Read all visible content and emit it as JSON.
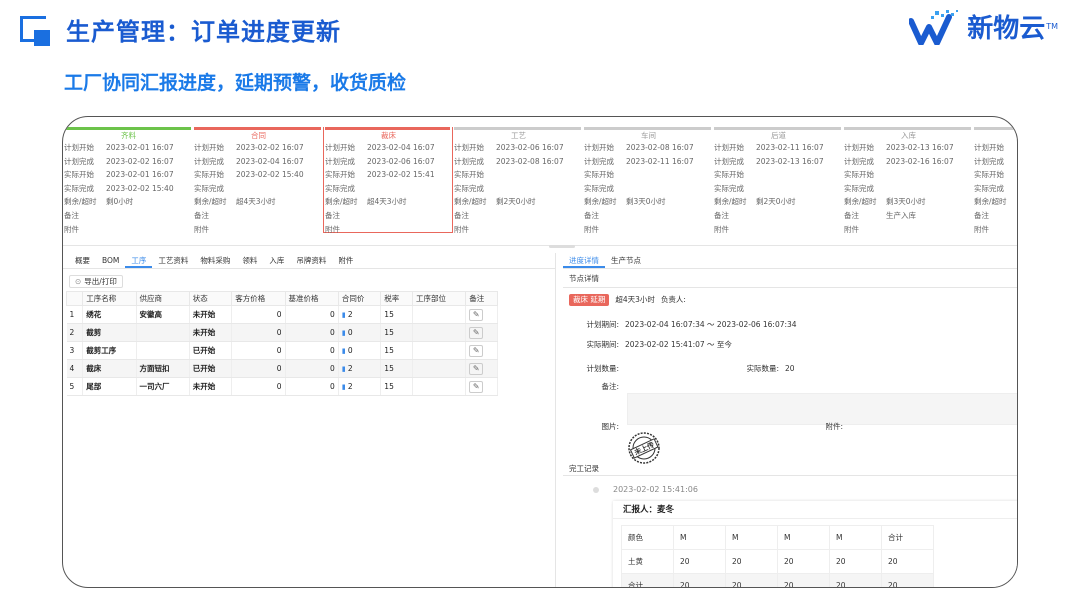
{
  "header": {
    "title": "生产管理：订单进度更新",
    "logo_text": "新物云",
    "logo_tm": "TM",
    "subtitle": "工厂协同汇报进度，延期预警，收货质检"
  },
  "stages": [
    {
      "name": "齐料",
      "state": "green",
      "rows": [
        [
          "计划开始",
          "2023-02-01 16:07"
        ],
        [
          "计划完成",
          "2023-02-02 16:07"
        ],
        [
          "实际开始",
          "2023-02-01 16:07"
        ],
        [
          "实际完成",
          "2023-02-02 15:40"
        ],
        [
          "剩余/超时",
          "剩0小时"
        ],
        [
          "备注",
          ""
        ],
        [
          "附件",
          ""
        ]
      ]
    },
    {
      "name": "合同",
      "state": "red",
      "rows": [
        [
          "计划开始",
          "2023-02-02 16:07"
        ],
        [
          "计划完成",
          "2023-02-04 16:07"
        ],
        [
          "实际开始",
          "2023-02-02 15:40"
        ],
        [
          "实际完成",
          ""
        ],
        [
          "剩余/超时",
          "超4天3小时"
        ],
        [
          "备注",
          ""
        ],
        [
          "附件",
          ""
        ]
      ]
    },
    {
      "name": "裁床",
      "state": "red-sel",
      "rows": [
        [
          "计划开始",
          "2023-02-04 16:07"
        ],
        [
          "计划完成",
          "2023-02-06 16:07"
        ],
        [
          "实际开始",
          "2023-02-02 15:41"
        ],
        [
          "实际完成",
          ""
        ],
        [
          "剩余/超时",
          "超4天3小时"
        ],
        [
          "备注",
          ""
        ],
        [
          "附件",
          ""
        ]
      ]
    },
    {
      "name": "工艺",
      "state": "grey",
      "rows": [
        [
          "计划开始",
          "2023-02-06 16:07"
        ],
        [
          "计划完成",
          "2023-02-08 16:07"
        ],
        [
          "实际开始",
          ""
        ],
        [
          "实际完成",
          ""
        ],
        [
          "剩余/超时",
          "剩2天0小时"
        ],
        [
          "备注",
          ""
        ],
        [
          "附件",
          ""
        ]
      ]
    },
    {
      "name": "车间",
      "state": "grey",
      "rows": [
        [
          "计划开始",
          "2023-02-08 16:07"
        ],
        [
          "计划完成",
          "2023-02-11 16:07"
        ],
        [
          "实际开始",
          ""
        ],
        [
          "实际完成",
          ""
        ],
        [
          "剩余/超时",
          "剩3天0小时"
        ],
        [
          "备注",
          ""
        ],
        [
          "附件",
          ""
        ]
      ]
    },
    {
      "name": "后道",
      "state": "grey",
      "rows": [
        [
          "计划开始",
          "2023-02-11 16:07"
        ],
        [
          "计划完成",
          "2023-02-13 16:07"
        ],
        [
          "实际开始",
          ""
        ],
        [
          "实际完成",
          ""
        ],
        [
          "剩余/超时",
          "剩2天0小时"
        ],
        [
          "备注",
          ""
        ],
        [
          "附件",
          ""
        ]
      ]
    },
    {
      "name": "入库",
      "state": "grey",
      "rows": [
        [
          "计划开始",
          "2023-02-13 16:07"
        ],
        [
          "计划完成",
          "2023-02-16 16:07"
        ],
        [
          "实际开始",
          ""
        ],
        [
          "实际完成",
          ""
        ],
        [
          "剩余/超时",
          "剩3天0小时"
        ],
        [
          "备注",
          "生产入库"
        ],
        [
          "附件",
          ""
        ]
      ]
    },
    {
      "name": "",
      "state": "grey",
      "rows": [
        [
          "计划开始",
          ""
        ],
        [
          "计划完成",
          ""
        ],
        [
          "实际开始",
          ""
        ],
        [
          "实际完成",
          ""
        ],
        [
          "剩余/超时",
          ""
        ],
        [
          "备注",
          ""
        ],
        [
          "附件",
          ""
        ]
      ]
    }
  ],
  "left_tabs": [
    "概要",
    "BOM",
    "工序",
    "工艺资料",
    "物料采购",
    "领料",
    "入库",
    "吊牌资料",
    "附件"
  ],
  "left_active_tab": 2,
  "export_label": "导出/打印",
  "table": {
    "headers": [
      "",
      "工序名称",
      "供应商",
      "状态",
      "客方价格",
      "基准价格",
      "合同价",
      "税率",
      "工序部位",
      "备注"
    ],
    "rows": [
      [
        "1",
        "绣花",
        "安徽高",
        "未开始",
        "0",
        "0",
        "2",
        "15",
        "",
        ""
      ],
      [
        "2",
        "截剪",
        "",
        "未开始",
        "0",
        "0",
        "0",
        "15",
        "",
        ""
      ],
      [
        "3",
        "截剪工序",
        "",
        "已开始",
        "0",
        "0",
        "0",
        "15",
        "",
        ""
      ],
      [
        "4",
        "截床",
        "方面钮扣",
        "已开始",
        "0",
        "0",
        "2",
        "15",
        "",
        ""
      ],
      [
        "5",
        "尾部",
        "一司六厂",
        "未开始",
        "0",
        "0",
        "2",
        "15",
        "",
        ""
      ]
    ]
  },
  "right": {
    "tabs": [
      "进度详情",
      "生产节点"
    ],
    "active_tab": 0,
    "section_label": "节点详情",
    "badge": "裁床 延期",
    "overdue": "超4天3小时",
    "owner_label": "负责人:",
    "plan_period_label": "计划期间:",
    "plan_period": "2023-02-04 16:07:34 ～ 2023-02-06 16:07:34",
    "actual_period_label": "实际期间:",
    "actual_period": "2023-02-02 15:41:07 ～ 至今",
    "plan_qty_label": "计划数量:",
    "actual_qty_label": "实际数量:",
    "actual_qty": "20",
    "note_label": "备注:",
    "image_label": "图片:",
    "attach_label": "附件:",
    "stamp_text": "未上传",
    "completion_label": "完工记录",
    "record_time": "2023-02-02 15:41:06",
    "reporter": "汇报人：麦冬",
    "report_table": [
      [
        "颜色",
        "M",
        "M",
        "M",
        "M",
        "合计"
      ],
      [
        "土黄",
        "20",
        "20",
        "20",
        "20",
        "20"
      ],
      [
        "合计",
        "20",
        "20",
        "20",
        "20",
        "20"
      ]
    ]
  },
  "colors": {
    "brand": "#1a5bd0",
    "accent": "#3b8bea",
    "green": "#6cc34a",
    "red": "#e9675c"
  },
  "icons": [
    "corner-square-icon",
    "logo-mark-icon",
    "print-icon",
    "thumb-up-icon",
    "edit-icon",
    "stamp-icon",
    "timeline-dot-icon"
  ]
}
